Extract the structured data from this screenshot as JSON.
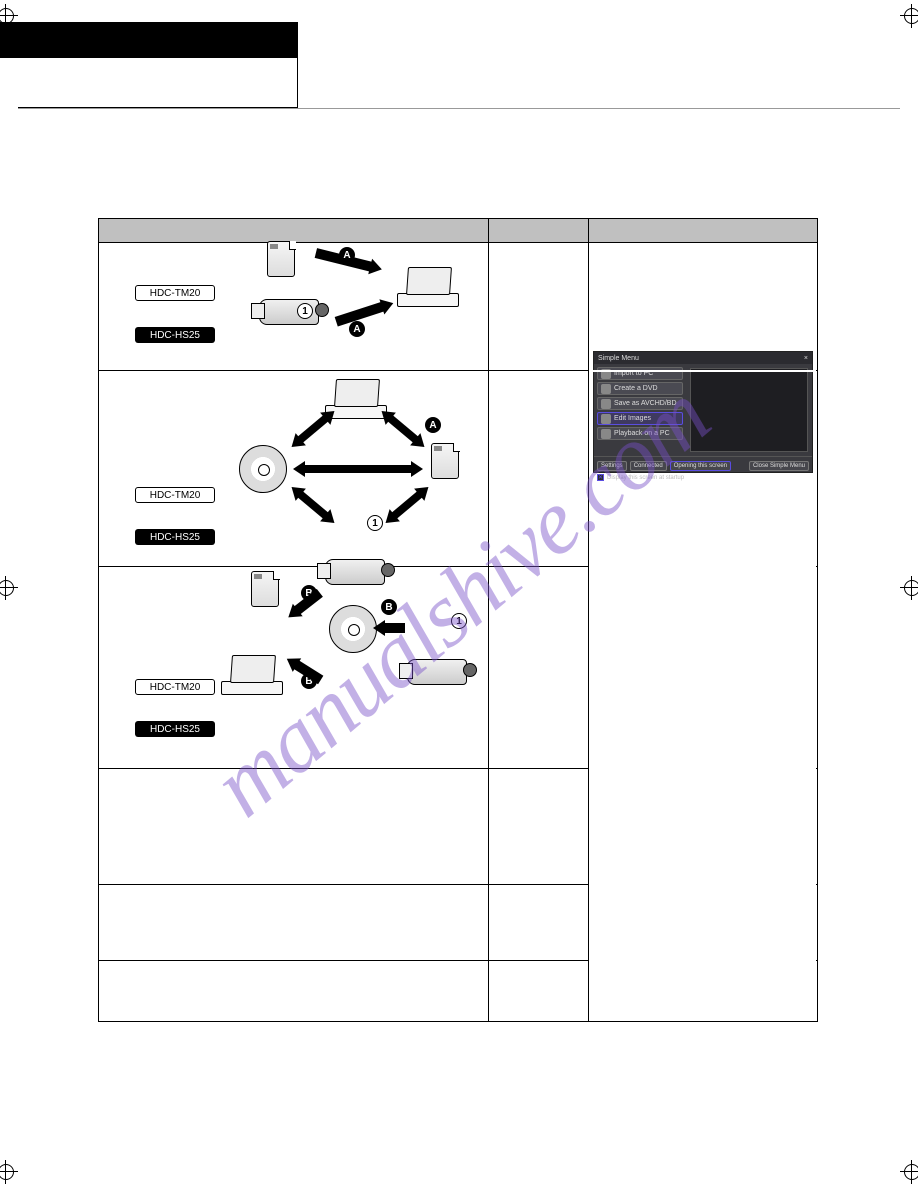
{
  "models": {
    "tm20": "HDC-TM20",
    "hs25": "HDC-HS25"
  },
  "markers": {
    "a": "A",
    "b": "B",
    "one": "1"
  },
  "app": {
    "title": "Simple Menu",
    "close": "×",
    "buttons": {
      "import": "Import to PC",
      "create_dvd": "Create a DVD",
      "save_bd": "Save as AVCHD/BD",
      "edit": "Edit Images",
      "playback": "Playback on a PC"
    },
    "footer": {
      "settings": "Settings",
      "connected": "Connected",
      "opening": "Opening this screen",
      "close_menu": "Close Simple Menu"
    },
    "check": "Display this screen at startup"
  },
  "watermark": "manualshive.com"
}
